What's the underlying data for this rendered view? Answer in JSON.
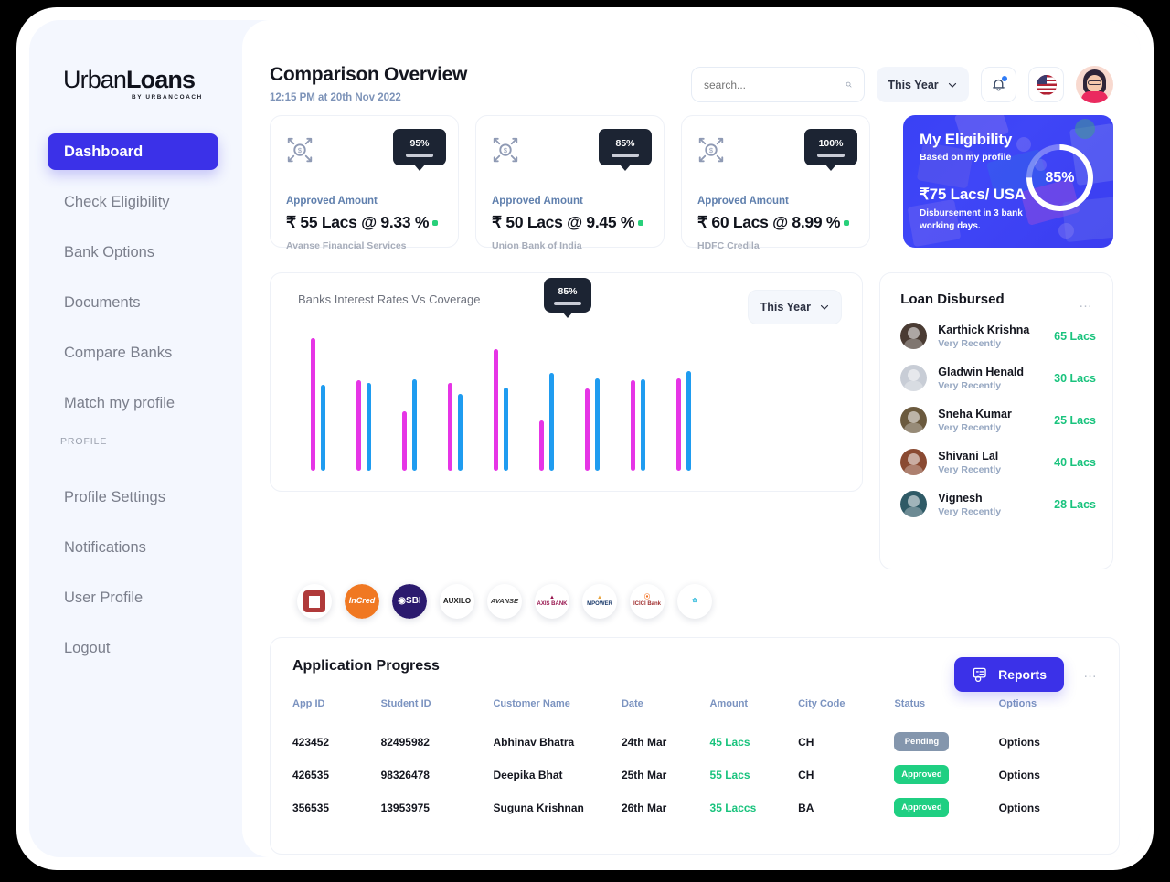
{
  "brand": {
    "name_light": "Urban",
    "name_bold": "Loans",
    "tagline": "BY URBANCOACH"
  },
  "sidebar": {
    "items": [
      {
        "label": "Dashboard",
        "active": true
      },
      {
        "label": "Check Eligibility",
        "active": false
      },
      {
        "label": "Bank Options",
        "active": false
      },
      {
        "label": "Documents",
        "active": false
      },
      {
        "label": "Compare Banks",
        "active": false
      },
      {
        "label": "Match my profile",
        "active": false
      }
    ],
    "section_label": "PROFILE",
    "profile_items": [
      {
        "label": "Profile Settings"
      },
      {
        "label": "Notifications"
      },
      {
        "label": "User Profile"
      },
      {
        "label": "Logout"
      }
    ]
  },
  "header": {
    "title": "Comparison Overview",
    "subtitle": "12:15 PM at 20th Nov 2022",
    "search_placeholder": "search...",
    "search_value": "",
    "period_label": "This Year",
    "flag": "us-flag-icon",
    "bell": "bell-icon"
  },
  "stat_cards": [
    {
      "badge": "95%",
      "label": "Approved Amount",
      "value": "₹ 55 Lacs @ 9.33 %",
      "bank": "Avanse Financial Services",
      "icon": "money-transfer-icon"
    },
    {
      "badge": "85%",
      "label": "Approved Amount",
      "value": "₹ 50 Lacs @ 9.45 %",
      "bank": "Union Bank of India",
      "icon": "money-transfer-icon"
    },
    {
      "badge": "100%",
      "label": "Approved Amount",
      "value": "₹ 60 Lacs @ 8.99 %",
      "bank": "HDFC Credila",
      "icon": "money-transfer-icon"
    }
  ],
  "eligibility": {
    "title": "My Eligibility",
    "subtitle": "Based on my profile",
    "amount": "₹75 Lacs/ USA",
    "note": "Disbursement in 3 bank working days.",
    "percent": "85%",
    "accent": "#3b31e8"
  },
  "chart_data": {
    "type": "bar",
    "title": "Banks Interest Rates Vs Coverage",
    "period_label": "This Year",
    "xlabel": "",
    "ylabel": "",
    "ylim": [
      0,
      100
    ],
    "grid": false,
    "legend": "none",
    "tooltip": {
      "value": "85%",
      "group_index": 6
    },
    "categories": [
      "IDFC First Bank",
      "InCred",
      "SBI",
      "Auxilo",
      "Avanse",
      "Axis Bank",
      "MPower",
      "ICICI Bank",
      "Prodigy Finance"
    ],
    "series": [
      {
        "name": "Interest Rate",
        "color": "#e635e6",
        "values": [
          100,
          68,
          45,
          66,
          92,
          38,
          62,
          68,
          70
        ]
      },
      {
        "name": "Coverage",
        "color": "#1f9cf0",
        "values": [
          65,
          66,
          69,
          58,
          63,
          74,
          70,
          69,
          75
        ]
      }
    ]
  },
  "bank_logos": [
    {
      "name": "IDFC FIRST Bank",
      "short": "IDFC",
      "color": "#b03a3a"
    },
    {
      "name": "InCred",
      "short": "InCred",
      "color": "#f07822"
    },
    {
      "name": "SBI",
      "short": "SBI",
      "color": "#2b1a6e"
    },
    {
      "name": "AUXILO",
      "short": "AUXILO",
      "color": "#1d1d1d"
    },
    {
      "name": "AVANSE",
      "short": "AVANSE",
      "color": "#3a3a3a"
    },
    {
      "name": "AXIS BANK",
      "short": "AXIS",
      "color": "#97144d"
    },
    {
      "name": "MPOWER Financing",
      "short": "MPOWER",
      "color": "#e8a33d"
    },
    {
      "name": "ICICI Bank",
      "short": "ICICI",
      "color": "#f37021"
    },
    {
      "name": "Prodigy Finance",
      "short": "Prodigy",
      "color": "#4cc3e0"
    }
  ],
  "loan_disbursed": {
    "title": "Loan Disbursed",
    "menu": "more-options",
    "items": [
      {
        "name": "Karthick Krishna",
        "time": "Very Recently",
        "amount": "65 Lacs",
        "avatar_color": "#4a3b33"
      },
      {
        "name": "Gladwin Henald",
        "time": "Very Recently",
        "amount": "30 Lacs",
        "avatar_color": "#c8cdd6"
      },
      {
        "name": "Sneha Kumar",
        "time": "Very Recently",
        "amount": "25 Lacs",
        "avatar_color": "#6b5a3e"
      },
      {
        "name": "Shivani Lal",
        "time": "Very Recently",
        "amount": "40 Lacs",
        "avatar_color": "#8a4a32"
      },
      {
        "name": "Vignesh",
        "time": "Very Recently",
        "amount": "28 Lacs",
        "avatar_color": "#2f5a66"
      }
    ]
  },
  "application_progress": {
    "title": "Application Progress",
    "reports_label": "Reports",
    "menu": "more-options",
    "columns": [
      "App ID",
      "Student ID",
      "Customer Name",
      "Date",
      "Amount",
      "City Code",
      "Status",
      "Options"
    ],
    "rows": [
      {
        "app_id": "423452",
        "student_id": "82495982",
        "customer": "Abhinav Bhatra",
        "date": "24th Mar",
        "amount": "45 Lacs",
        "city": "CH",
        "status": "Pending",
        "status_kind": "pending",
        "options": "Options"
      },
      {
        "app_id": "426535",
        "student_id": "98326478",
        "customer": "Deepika Bhat",
        "date": "25th Mar",
        "amount": "55 Lacs",
        "city": "CH",
        "status": "Approved",
        "status_kind": "approved",
        "options": "Options"
      },
      {
        "app_id": "356535",
        "student_id": "13953975",
        "customer": "Suguna Krishnan",
        "date": "26th Mar",
        "amount": "35 Laccs",
        "city": "BA",
        "status": "Approved",
        "status_kind": "approved",
        "options": "Options"
      }
    ]
  }
}
